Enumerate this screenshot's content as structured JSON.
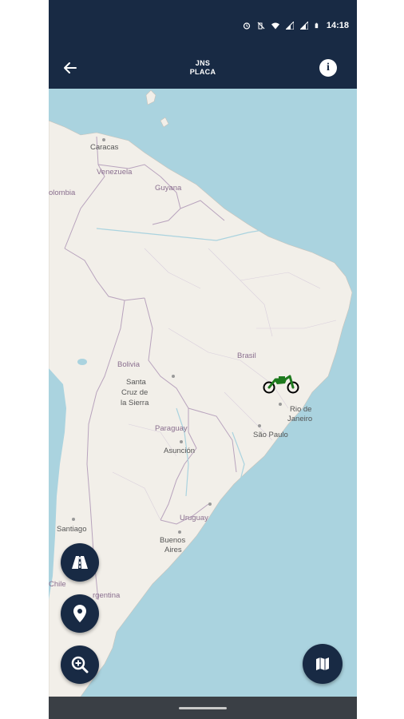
{
  "status_bar": {
    "time": "14:18",
    "icons": [
      "alarm-icon",
      "vibrate-off-icon",
      "wifi-icon",
      "signal-icon",
      "signal-icon-2",
      "battery-icon"
    ]
  },
  "header": {
    "title_line1": "JNS",
    "title_line2": "PLACA",
    "back_icon": "arrow-left-icon",
    "info_icon": "info-icon"
  },
  "map": {
    "labels": {
      "caracas": "Caracas",
      "venezuela": "Venezuela",
      "colombia": "olombia",
      "guyana": "Guyana",
      "brasil": "Brasil",
      "bolivia": "Bolivia",
      "santa_cruz_1": "Santa",
      "santa_cruz_2": "Cruz de",
      "santa_cruz_3": "la Sierra",
      "paraguay": "Paraguay",
      "asuncion": "Asunción",
      "rio_1": "Rio de",
      "rio_2": "Janeiro",
      "sao_paulo": "São Paulo",
      "uruguay": "Uruguay",
      "buenos_aires_1": "Buenos",
      "buenos_aires_2": "Aires",
      "santiago": "Santiago",
      "chile": "Chile",
      "argentina": "rgentina"
    },
    "vehicle_marker": {
      "icon": "motorcycle-icon",
      "color": "#1e7a1e"
    }
  },
  "fabs": {
    "route": {
      "icon": "road-icon"
    },
    "location": {
      "icon": "location-pin-icon"
    },
    "zoom": {
      "icon": "zoom-in-icon"
    },
    "map_layers": {
      "icon": "map-icon"
    }
  },
  "colors": {
    "header_bg": "#182a44",
    "water": "#aad3df",
    "land": "#f2efe9",
    "border": "#b8a3bd"
  }
}
